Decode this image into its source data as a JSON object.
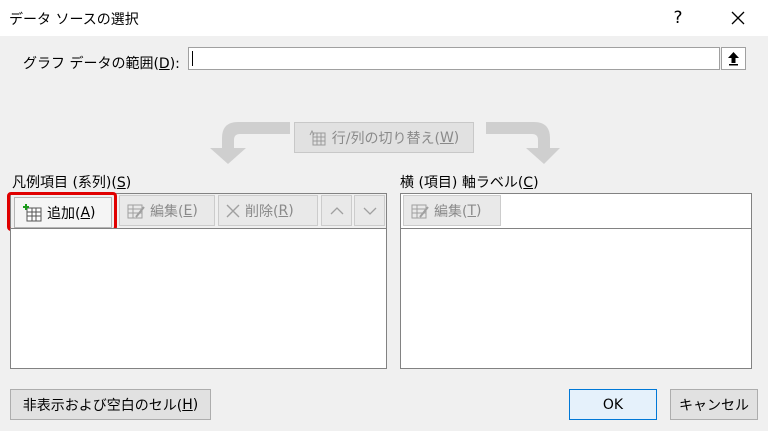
{
  "window": {
    "title": "データ ソースの選択",
    "help_label": "?"
  },
  "range": {
    "label_pre": "グラフ データの範囲(",
    "label_key": "D",
    "label_post": "):",
    "value": ""
  },
  "switch": {
    "label_pre": "行/列の切り替え(",
    "label_key": "W",
    "label_post": ")"
  },
  "series": {
    "label_pre": "凡例項目 (系列)(",
    "label_key": "S",
    "label_post": ")",
    "add_pre": "追加(",
    "add_key": "A",
    "add_post": ")",
    "edit_pre": "編集(",
    "edit_key": "E",
    "edit_post": ")",
    "delete_pre": "削除(",
    "delete_key": "R",
    "delete_post": ")",
    "items": []
  },
  "axis": {
    "label_pre": "横 (項目) 軸ラベル(",
    "label_key": "C",
    "label_post": ")",
    "edit_pre": "編集(",
    "edit_key": "T",
    "edit_post": ")",
    "items": []
  },
  "buttons": {
    "hidden_pre": "非表示および空白のセル(",
    "hidden_key": "H",
    "hidden_post": ")",
    "ok": "OK",
    "cancel": "キャンセル"
  },
  "colors": {
    "highlight": "#e00000",
    "ok_border": "#0078d7"
  }
}
